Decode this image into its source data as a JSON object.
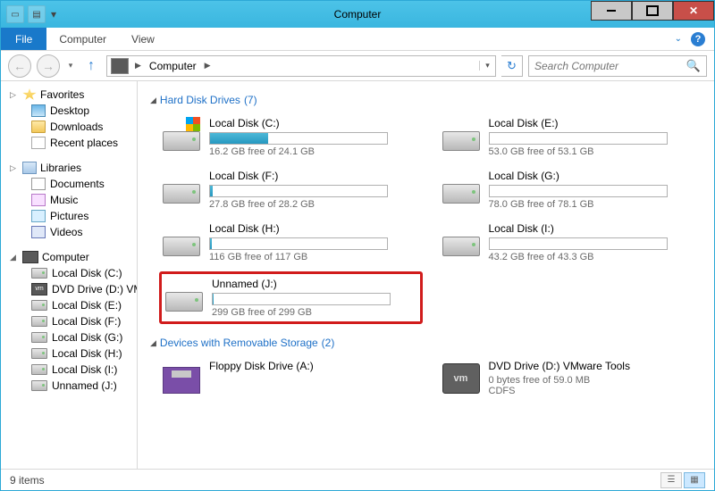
{
  "window": {
    "title": "Computer"
  },
  "ribbon": {
    "file": "File",
    "tabs": [
      "Computer",
      "View"
    ]
  },
  "nav": {
    "breadcrumb": [
      "Computer"
    ],
    "search_placeholder": "Search Computer"
  },
  "sidebar": {
    "favorites": {
      "label": "Favorites",
      "items": [
        "Desktop",
        "Downloads",
        "Recent places"
      ]
    },
    "libraries": {
      "label": "Libraries",
      "items": [
        "Documents",
        "Music",
        "Pictures",
        "Videos"
      ]
    },
    "computer": {
      "label": "Computer",
      "items": [
        "Local Disk (C:)",
        "DVD Drive (D:) VMware Tools",
        "Local Disk (E:)",
        "Local Disk (F:)",
        "Local Disk (G:)",
        "Local Disk (H:)",
        "Local Disk (I:)",
        "Unnamed (J:)"
      ]
    }
  },
  "sections": {
    "hdd": {
      "label": "Hard Disk Drives",
      "count": "(7)"
    },
    "removable": {
      "label": "Devices with Removable Storage",
      "count": "(2)"
    }
  },
  "drives": {
    "c": {
      "name": "Local Disk (C:)",
      "free": "16.2 GB free of 24.1 GB",
      "pct": 33
    },
    "e": {
      "name": "Local Disk (E:)",
      "free": "53.0 GB free of 53.1 GB",
      "pct": 0
    },
    "f": {
      "name": "Local Disk (F:)",
      "free": "27.8 GB free of 28.2 GB",
      "pct": 1
    },
    "g": {
      "name": "Local Disk (G:)",
      "free": "78.0 GB free of 78.1 GB",
      "pct": 0
    },
    "h": {
      "name": "Local Disk (H:)",
      "free": "116 GB free of 117 GB",
      "pct": 1
    },
    "i": {
      "name": "Local Disk (I:)",
      "free": "43.2 GB free of 43.3 GB",
      "pct": 0
    },
    "j": {
      "name": "Unnamed (J:)",
      "free": "299 GB free of 299 GB",
      "pct": 0
    }
  },
  "removable": {
    "floppy": {
      "name": "Floppy Disk Drive (A:)"
    },
    "dvd": {
      "name": "DVD Drive (D:) VMware Tools",
      "free": "0 bytes free of 59.0 MB",
      "fs": "CDFS"
    }
  },
  "status": {
    "count": "9 items"
  }
}
